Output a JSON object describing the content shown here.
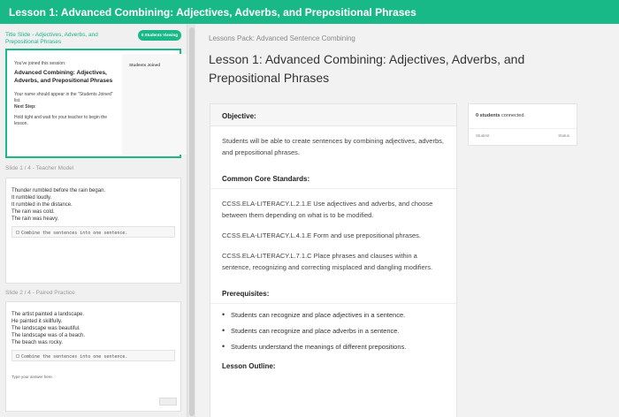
{
  "topbar": {
    "title": "Lesson 1:  Advanced Combining: Adjectives, Adverbs, and Prepositional Phrases"
  },
  "sidebar": {
    "title_slide": {
      "header": "Title Slide - Adjectives, Adverbs, and Prepositional Phrases",
      "badge": "0 Students Viewing",
      "joined": "You've joined this session:",
      "lesson": "Advanced Combining: Adjectives, Adverbs, and Prepositional Phrases",
      "name_note": "Your name should appear in the \"Students Joined\" list.",
      "next_step": "Next Step:",
      "wait": "Hold tight and wait for your teacher to begin the lesson.",
      "students_joined": "Students Joined"
    },
    "slide1": {
      "header": "Slide 1 / 4 - Teacher Model",
      "lines": [
        "Thunder rumbled before the rain began.",
        "It rumbled loudly.",
        "It rumbled in the distance.",
        "The rain was cold.",
        "The rain was heavy."
      ],
      "task": "Combine the sentences into one sentence."
    },
    "slide2": {
      "header": "Slide 2 / 4 - Paired Practice",
      "lines": [
        "The artist painted a landscape.",
        "He painted it skillfully.",
        "The landscape was beautiful.",
        "The landscape was of a beach.",
        "The beach was rocky."
      ],
      "task": "Combine the sentences into one sentence.",
      "answer_placeholder": "Type your answer here."
    }
  },
  "main": {
    "pack": "Lessons Pack: Advanced Sentence Combining",
    "title": "Lesson 1: Advanced Combining: Adjectives, Adverbs, and Prepositional Phrases",
    "objective_head": "Objective:",
    "objective": "Students will be able to create sentences by combining adjectives, adverbs, and prepositional phrases.",
    "standards_head": "Common Core Standards:",
    "standards": [
      "CCSS.ELA-LITERACY.L.2.1.E Use adjectives and adverbs, and choose between them depending on what is to be modified.",
      "CCSS.ELA-LITERACY.L.4.1.E Form and use prepositional phrases.",
      "CCSS.ELA-LITERACY.L.7.1.C Place phrases and clauses within a sentence, recognizing and correcting misplaced and dangling modifiers."
    ],
    "prereq_head": "Prerequisites:",
    "prereqs": [
      "Students can recognize and place adjectives in a sentence.",
      "Students can recognize and place adverbs in a sentence.",
      "Students understand the meanings of different prepositions."
    ],
    "outline_head": "Lesson Outline:"
  },
  "students_panel": {
    "count": "0 students",
    "connected": " connected.",
    "col_student": "Student",
    "col_status": "Status"
  },
  "colors": {
    "accent": "#19b987"
  }
}
